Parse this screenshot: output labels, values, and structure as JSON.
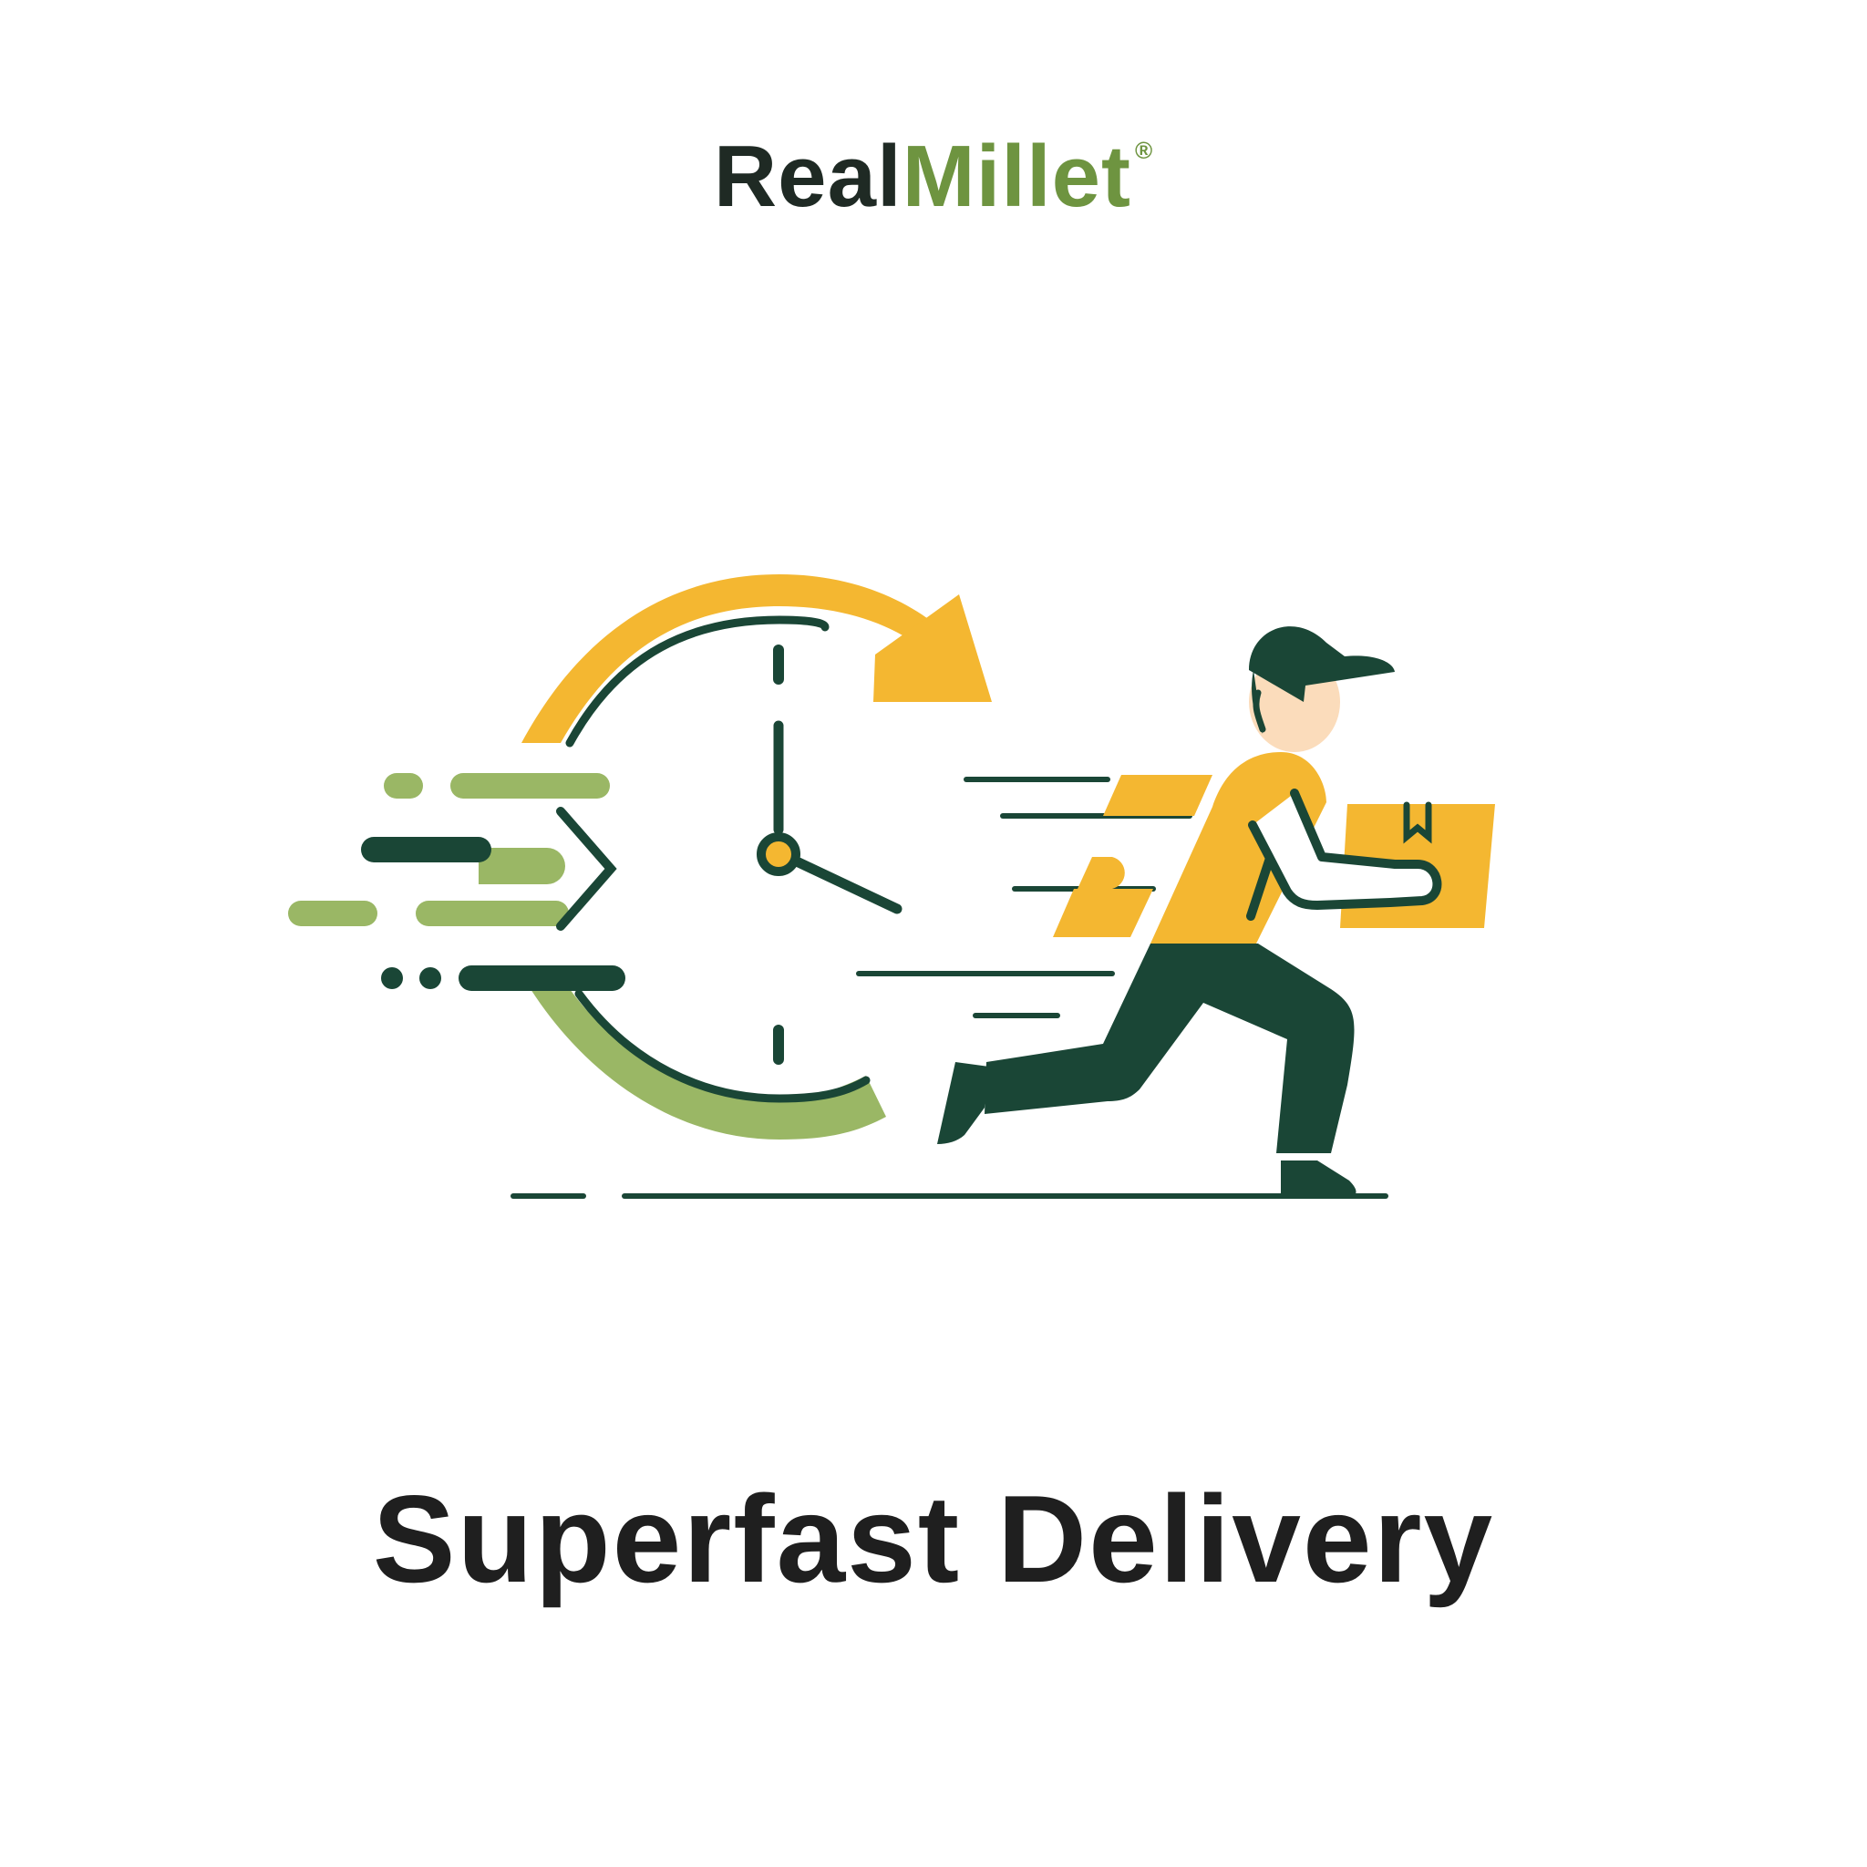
{
  "brand": {
    "name_part1": "Real",
    "name_part2": "Millet",
    "registered_mark": "®"
  },
  "headline": "Superfast Delivery",
  "illustration": {
    "icons": [
      "clock-icon",
      "refresh-arrow-icon",
      "delivery-person-icon",
      "package-icon",
      "speed-lines-icon"
    ]
  },
  "colors": {
    "dark_green": "#1a4636",
    "light_green": "#9ab765",
    "brand_green": "#6e9440",
    "yellow": "#f4b731",
    "skin": "#fbdcbb",
    "text_dark": "#1f1f1f"
  }
}
